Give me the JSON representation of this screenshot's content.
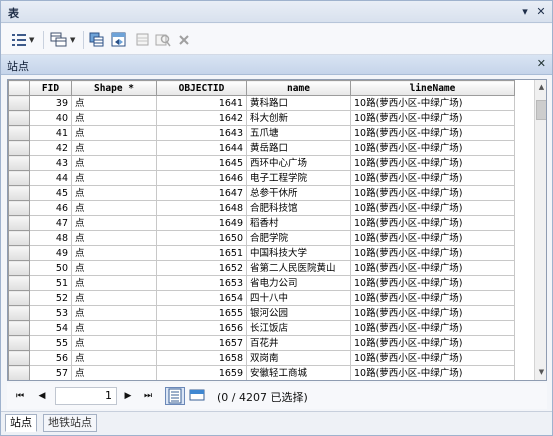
{
  "window": {
    "title": "表"
  },
  "layer": {
    "name": "站点"
  },
  "columns": [
    "FID",
    "Shape *",
    "OBJECTID",
    "name",
    "lineName"
  ],
  "rows": [
    [
      "39",
      "点",
      "1641",
      "黄科路口",
      "10路(萝西小区-中绿广场)"
    ],
    [
      "40",
      "点",
      "1642",
      "科大创新",
      "10路(萝西小区-中绿广场)"
    ],
    [
      "41",
      "点",
      "1643",
      "五爪塘",
      "10路(萝西小区-中绿广场)"
    ],
    [
      "42",
      "点",
      "1644",
      "黄岳路口",
      "10路(萝西小区-中绿广场)"
    ],
    [
      "43",
      "点",
      "1645",
      "西环中心广场",
      "10路(萝西小区-中绿广场)"
    ],
    [
      "44",
      "点",
      "1646",
      "电子工程学院",
      "10路(萝西小区-中绿广场)"
    ],
    [
      "45",
      "点",
      "1647",
      "总参干休所",
      "10路(萝西小区-中绿广场)"
    ],
    [
      "46",
      "点",
      "1648",
      "合肥科技馆",
      "10路(萝西小区-中绿广场)"
    ],
    [
      "47",
      "点",
      "1649",
      "稻香村",
      "10路(萝西小区-中绿广场)"
    ],
    [
      "48",
      "点",
      "1650",
      "合肥学院",
      "10路(萝西小区-中绿广场)"
    ],
    [
      "49",
      "点",
      "1651",
      "中国科技大学",
      "10路(萝西小区-中绿广场)"
    ],
    [
      "50",
      "点",
      "1652",
      "省第二人民医院黄山",
      "10路(萝西小区-中绿广场)"
    ],
    [
      "51",
      "点",
      "1653",
      "省电力公司",
      "10路(萝西小区-中绿广场)"
    ],
    [
      "52",
      "点",
      "1654",
      "四十八中",
      "10路(萝西小区-中绿广场)"
    ],
    [
      "53",
      "点",
      "1655",
      "银河公园",
      "10路(萝西小区-中绿广场)"
    ],
    [
      "54",
      "点",
      "1656",
      "长江饭店",
      "10路(萝西小区-中绿广场)"
    ],
    [
      "55",
      "点",
      "1657",
      "百花井",
      "10路(萝西小区-中绿广场)"
    ],
    [
      "56",
      "点",
      "1658",
      "双岗南",
      "10路(萝西小区-中绿广场)"
    ],
    [
      "57",
      "点",
      "1659",
      "安徽轻工商城",
      "10路(萝西小区-中绿广场)"
    ]
  ],
  "nav": {
    "page": "1",
    "selection": "(0 / 4207 已选择)"
  },
  "tabs": [
    {
      "label": "站点",
      "active": true
    },
    {
      "label": "地铁站点",
      "active": false
    }
  ],
  "icons": [
    "table-options-icon",
    "related-tables-icon",
    "select-by-attributes-icon",
    "switch-selection-icon",
    "clear-selection-icon",
    "zoom-selected-icon",
    "delete-selected-icon"
  ]
}
